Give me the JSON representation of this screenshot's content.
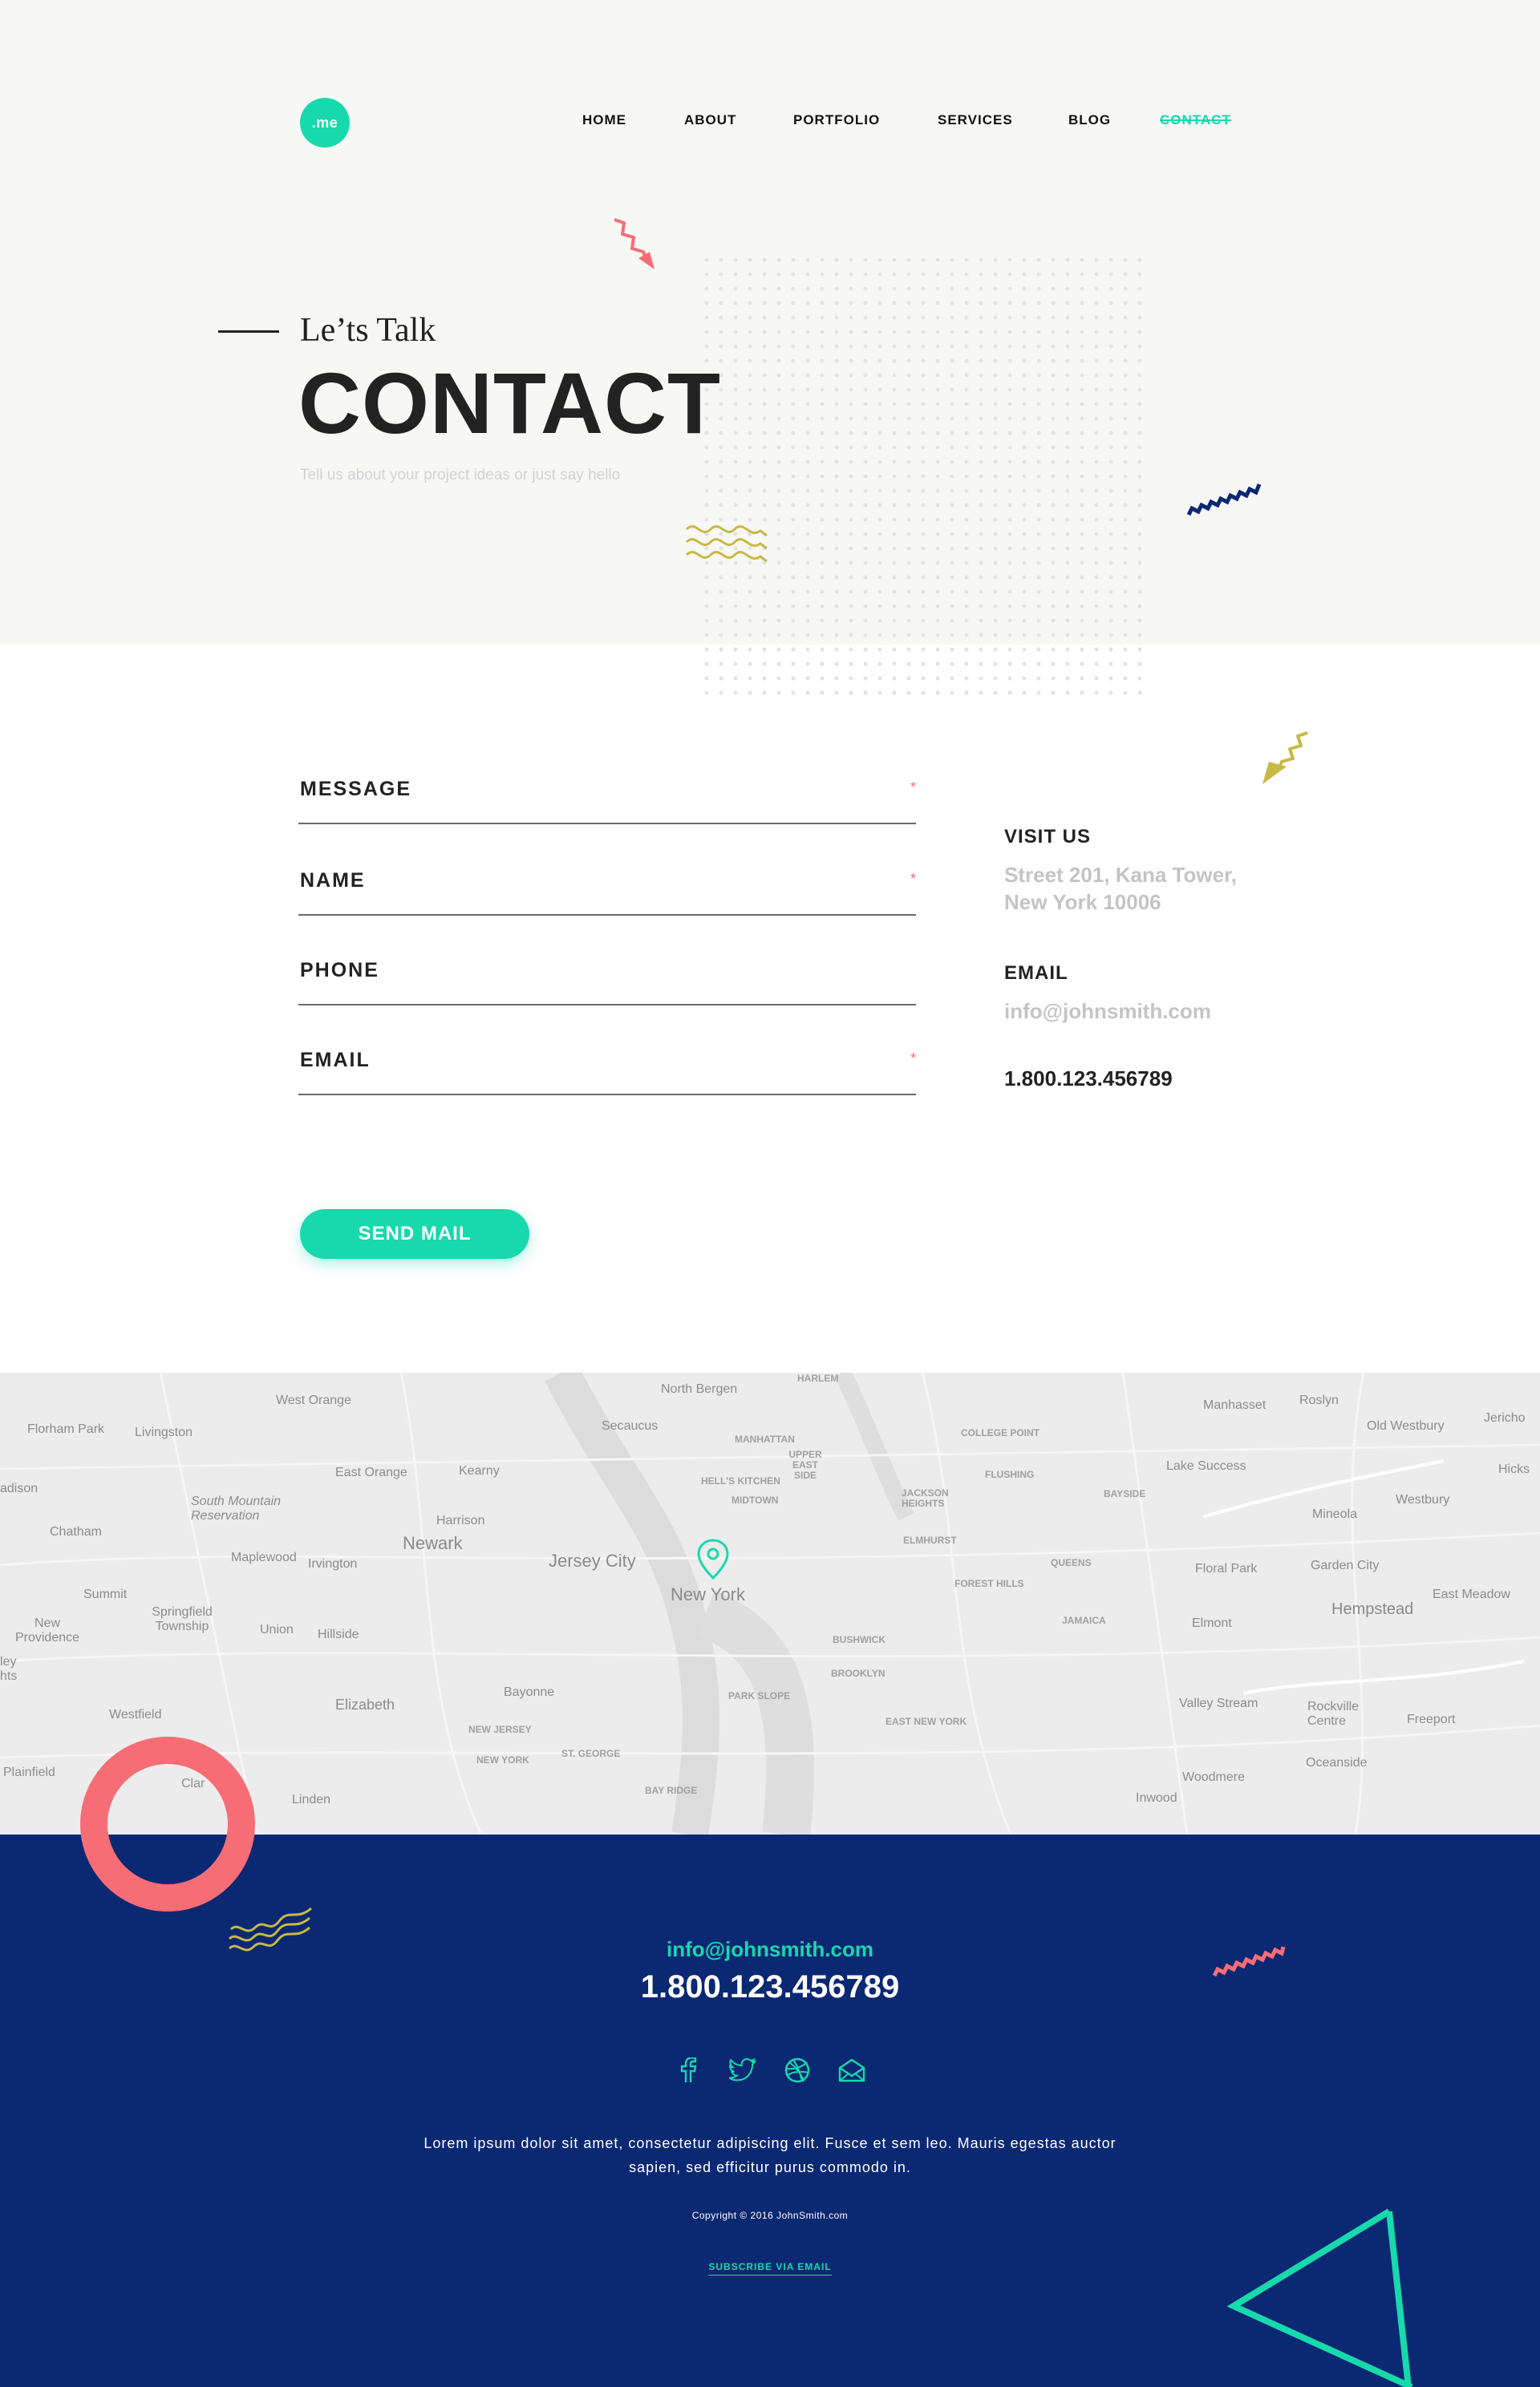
{
  "logo": {
    "text": ".me"
  },
  "nav": {
    "items": [
      {
        "label": "HOME"
      },
      {
        "label": "ABOUT"
      },
      {
        "label": "PORTFOLIO"
      },
      {
        "label": "SERVICES"
      },
      {
        "label": "BLOG"
      },
      {
        "label": "CONTACT",
        "active": true
      }
    ]
  },
  "hero": {
    "kicker": "Le’ts Talk",
    "title": "CONTACT",
    "subtitle": "Tell us about your project ideas or just say hello"
  },
  "form": {
    "fields": [
      {
        "label": "MESSAGE",
        "required": "*"
      },
      {
        "label": "NAME",
        "required": "*"
      },
      {
        "label": "PHONE",
        "required": ""
      },
      {
        "label": "EMAIL",
        "required": "*"
      }
    ],
    "submit_label": "SEND MAIL"
  },
  "contact_info": {
    "visit_heading": "VISIT US",
    "address_line1": "Street 201, Kana Tower,",
    "address_line2": "New York 10006",
    "email_heading": "EMAIL",
    "email": "info@johnsmith.com",
    "phone": "1.800.123.456789"
  },
  "map": {
    "labels": [
      {
        "text": "West Orange",
        "cls": ""
      },
      {
        "text": "North Bergen",
        "cls": ""
      },
      {
        "text": "HARLEM",
        "cls": "sm"
      },
      {
        "text": "Florham Park",
        "cls": ""
      },
      {
        "text": "Livingston",
        "cls": ""
      },
      {
        "text": "Secaucus",
        "cls": ""
      },
      {
        "text": "MANHATTAN",
        "cls": "sm"
      },
      {
        "text": "UPPER EAST SIDE",
        "cls": "sm"
      },
      {
        "text": "COLLEGE POINT",
        "cls": "sm"
      },
      {
        "text": "Manhasset",
        "cls": ""
      },
      {
        "text": "Roslyn",
        "cls": ""
      },
      {
        "text": "Old Westbury",
        "cls": ""
      },
      {
        "text": "Jericho",
        "cls": ""
      },
      {
        "text": "East Orange",
        "cls": ""
      },
      {
        "text": "Kearny",
        "cls": ""
      },
      {
        "text": "HELL'S KITCHEN",
        "cls": "sm"
      },
      {
        "text": "FLUSHING",
        "cls": "sm"
      },
      {
        "text": "Lake Success",
        "cls": ""
      },
      {
        "text": "Hicks",
        "cls": ""
      },
      {
        "text": "adison",
        "cls": ""
      },
      {
        "text": "MIDTOWN",
        "cls": "sm"
      },
      {
        "text": "JACKSON HEIGHTS",
        "cls": "sm"
      },
      {
        "text": "BAYSIDE",
        "cls": "sm"
      },
      {
        "text": "Westbury",
        "cls": ""
      },
      {
        "text": "South Mountain Reservation",
        "cls": ""
      },
      {
        "text": "Chatham",
        "cls": ""
      },
      {
        "text": "Harrison",
        "cls": ""
      },
      {
        "text": "Mineola",
        "cls": ""
      },
      {
        "text": "Newark",
        "cls": "lg"
      },
      {
        "text": "Maplewood",
        "cls": ""
      },
      {
        "text": "Irvington",
        "cls": ""
      },
      {
        "text": "Jersey City",
        "cls": "lg"
      },
      {
        "text": "ELMHURST",
        "cls": "sm"
      },
      {
        "text": "QUEENS",
        "cls": "sm"
      },
      {
        "text": "Floral Park",
        "cls": ""
      },
      {
        "text": "Garden City",
        "cls": ""
      },
      {
        "text": "FOREST HILLS",
        "cls": "sm"
      },
      {
        "text": "Summit",
        "cls": ""
      },
      {
        "text": "New York",
        "cls": "lg"
      },
      {
        "text": "East Meadow",
        "cls": ""
      },
      {
        "text": "Hempstead",
        "cls": "lg"
      },
      {
        "text": "Springfield Township",
        "cls": ""
      },
      {
        "text": "New Providence",
        "cls": ""
      },
      {
        "text": "Union",
        "cls": ""
      },
      {
        "text": "Hillside",
        "cls": ""
      },
      {
        "text": "JAMAICA",
        "cls": "sm"
      },
      {
        "text": "Elmont",
        "cls": ""
      },
      {
        "text": "BUSHWICK",
        "cls": "sm"
      },
      {
        "text": "BROOKLYN",
        "cls": "sm"
      },
      {
        "text": "Bayonne",
        "cls": ""
      },
      {
        "text": "PARK SLOPE",
        "cls": "sm"
      },
      {
        "text": "Valley Stream",
        "cls": ""
      },
      {
        "text": "Rockville Centre",
        "cls": ""
      },
      {
        "text": "Elizabeth",
        "cls": ""
      },
      {
        "text": "Westfield",
        "cls": ""
      },
      {
        "text": "Freeport",
        "cls": ""
      },
      {
        "text": "NEW JERSEY",
        "cls": "sm"
      },
      {
        "text": "EAST NEW YORK",
        "cls": "sm"
      },
      {
        "text": "NEW YORK",
        "cls": "sm"
      },
      {
        "text": "ST. GEORGE",
        "cls": "sm"
      },
      {
        "text": "Oceanside",
        "cls": ""
      },
      {
        "text": "Plainfield",
        "cls": ""
      },
      {
        "text": "Woodmere",
        "cls": ""
      },
      {
        "text": "Linden",
        "cls": ""
      },
      {
        "text": "BAY RIDGE",
        "cls": "sm"
      },
      {
        "text": "Inwood",
        "cls": ""
      },
      {
        "text": "ley hts",
        "cls": ""
      },
      {
        "text": "Clar",
        "cls": ""
      }
    ],
    "pin_icon": "map-pin-icon"
  },
  "footer": {
    "email": "info@johnsmith.com",
    "phone": "1.800.123.456789",
    "socials": [
      {
        "name": "facebook-icon"
      },
      {
        "name": "twitter-icon"
      },
      {
        "name": "dribbble-icon"
      },
      {
        "name": "mail-icon"
      }
    ],
    "about": "Lorem ipsum dolor sit amet, consectetur adipiscing elit. Fusce et sem leo. Mauris egestas auctor sapien, sed efficitur purus commodo in.",
    "copyright": "Copyright © 2016 JohnSmith.com",
    "subscribe": "SUBSCRIBE VIA EMAIL"
  },
  "colors": {
    "accent": "#17d9ac",
    "navy": "#0b2872",
    "coral": "#f76d75",
    "olive": "#c7b946",
    "hero_bg": "#f7f7f6"
  }
}
